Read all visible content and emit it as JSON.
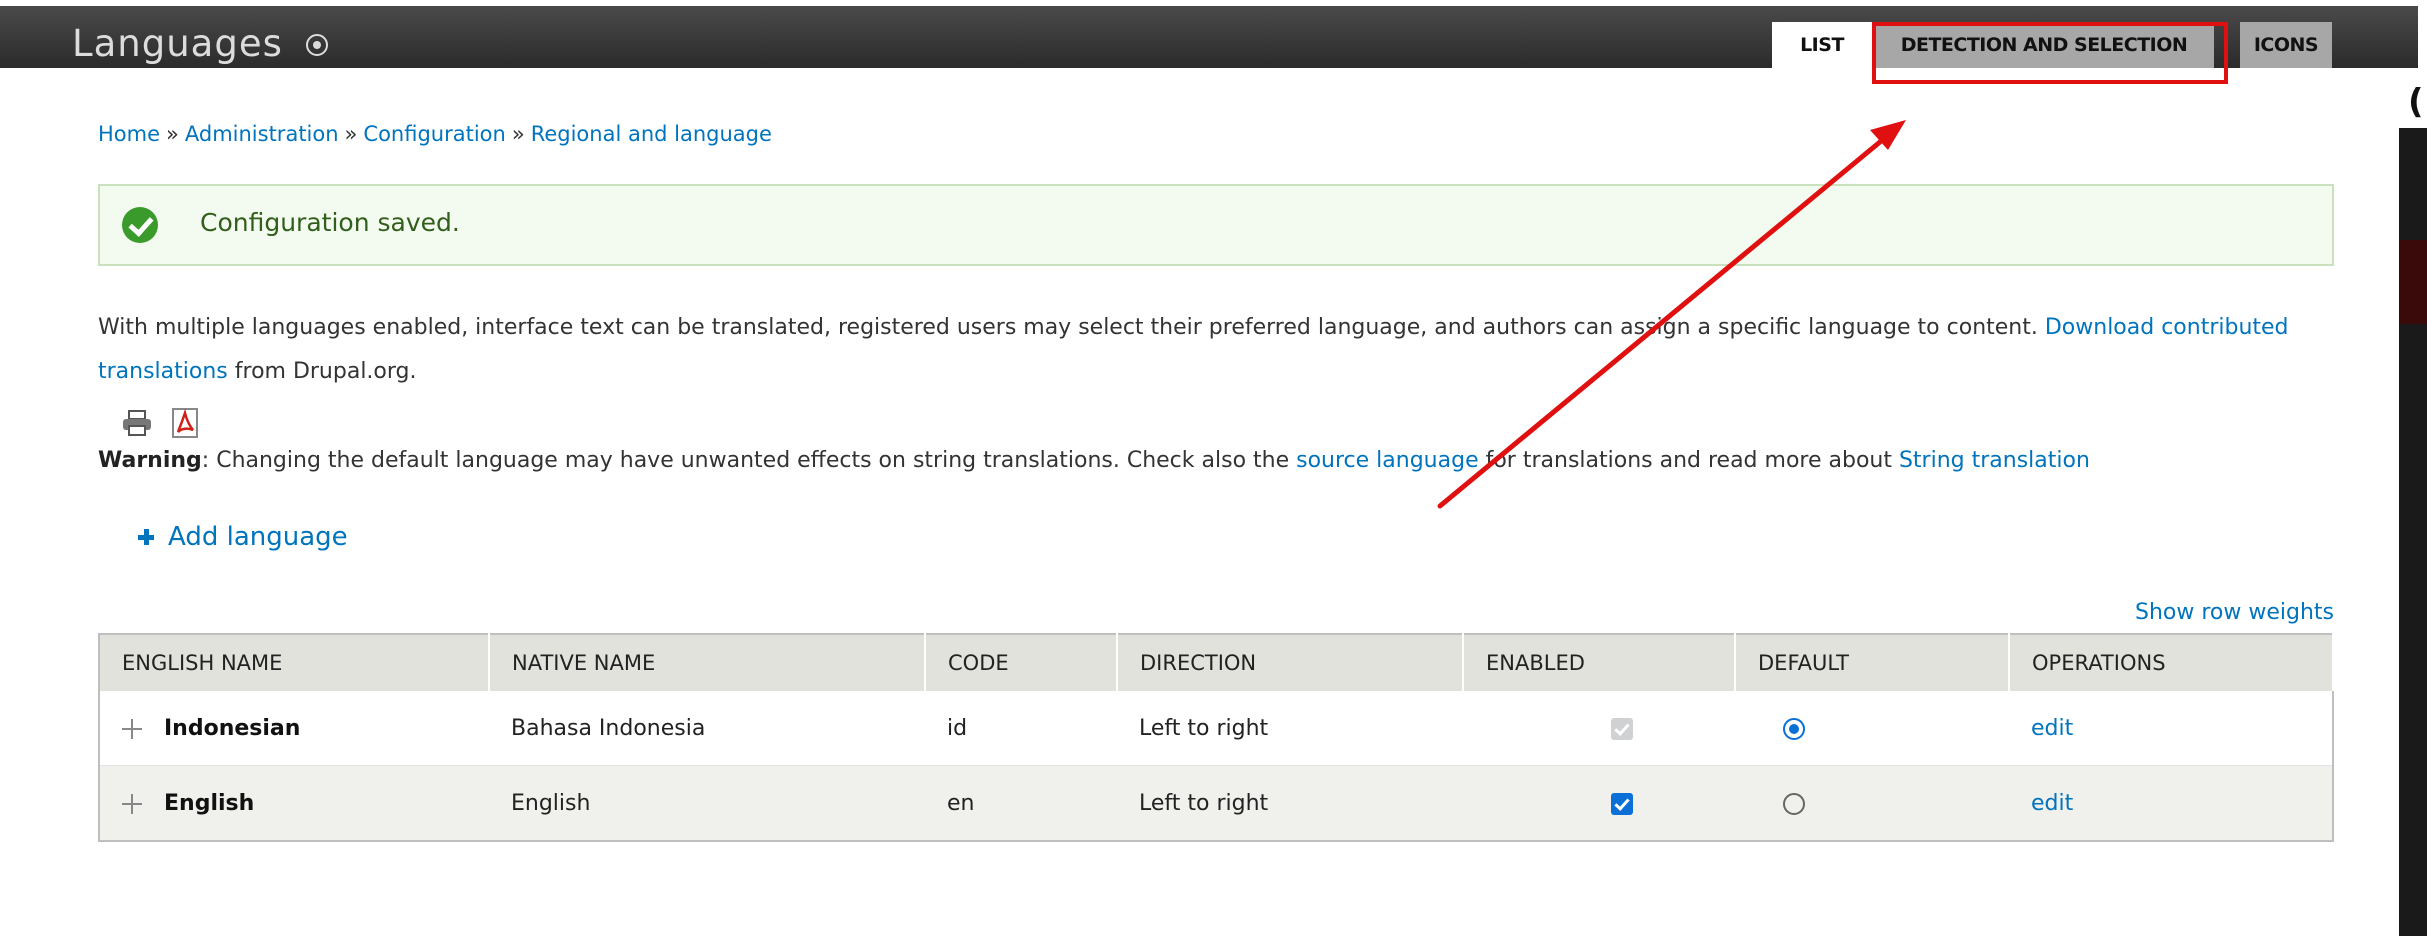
{
  "header": {
    "title": "Languages",
    "tabs": [
      {
        "label": "LIST",
        "active": true
      },
      {
        "label": "DETECTION AND SELECTION",
        "active": false
      },
      {
        "label": "ICONS",
        "active": false
      }
    ]
  },
  "breadcrumb": [
    "Home",
    "Administration",
    "Configuration",
    "Regional and language"
  ],
  "breadcrumb_separator": "»",
  "status": {
    "message": "Configuration saved."
  },
  "description": {
    "text_before": "With multiple languages enabled, interface text can be translated, registered users may select their preferred language, and authors can assign a specific language to content. ",
    "link": "Download contributed translations",
    "text_after": " from Drupal.org."
  },
  "warning": {
    "label": "Warning",
    "text_1": ": Changing the default language may have unwanted effects on string translations. Check also the ",
    "link_1": "source language",
    "text_2": " for translations and read more about ",
    "link_2": "String translation"
  },
  "add_language": "Add language",
  "show_row_weights": "Show row weights",
  "table": {
    "columns": [
      "ENGLISH NAME",
      "NATIVE NAME",
      "CODE",
      "DIRECTION",
      "ENABLED",
      "DEFAULT",
      "OPERATIONS"
    ],
    "rows": [
      {
        "english_name": "Indonesian",
        "native_name": "Bahasa Indonesia",
        "code": "id",
        "direction": "Left to right",
        "enabled": true,
        "enabled_disabled": true,
        "default": true,
        "operation": "edit"
      },
      {
        "english_name": "English",
        "native_name": "English",
        "code": "en",
        "direction": "Left to right",
        "enabled": true,
        "enabled_disabled": false,
        "default": false,
        "operation": "edit"
      }
    ]
  },
  "colors": {
    "link": "#0074bd",
    "header_bg": "#333333",
    "status_bg": "#f3faef",
    "annotation": "#e01010"
  }
}
